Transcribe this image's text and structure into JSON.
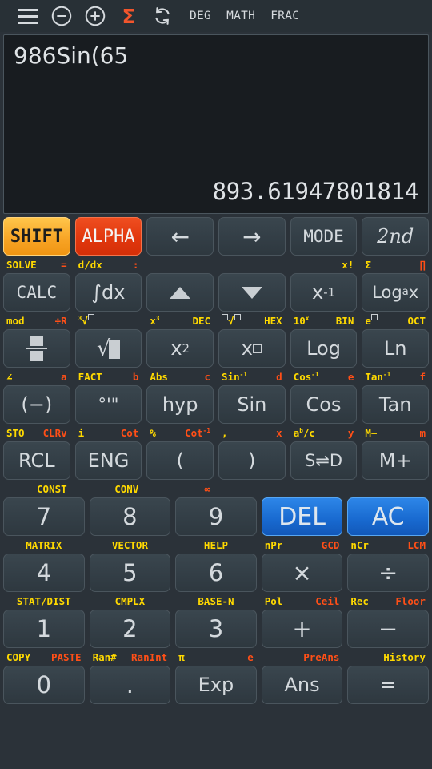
{
  "topbar": {
    "menu_icon": "hamburger-menu-icon",
    "zoom_out_icon": "minus-circle-icon",
    "zoom_in_icon": "plus-circle-icon",
    "sigma_icon": "Σ",
    "refresh_icon": "refresh-icon",
    "modes": [
      "DEG",
      "MATH",
      "FRAC"
    ]
  },
  "display": {
    "expression": "986Sin(65",
    "result": "893.61947801814"
  },
  "keys": [
    {
      "row": 1,
      "cells": [
        {
          "main": "SHIFT",
          "style": "shift",
          "name": "shift-key",
          "left": "SOLVE",
          "right": "=",
          "lc": "y",
          "rc": "r"
        },
        {
          "main": "ALPHA",
          "style": "alpha",
          "name": "alpha-key",
          "left": "d/dx",
          "right": ":",
          "lc": "y",
          "rc": "r"
        },
        {
          "main": "←",
          "style": "arrow",
          "name": "left-arrow-key",
          "left": "",
          "right": "",
          "lc": "y",
          "rc": "r"
        },
        {
          "main": "→",
          "style": "arrow",
          "name": "right-arrow-key",
          "left": "",
          "right": "",
          "lc": "y",
          "rc": "r"
        },
        {
          "main": "MODE",
          "style": "mono",
          "name": "mode-key",
          "left": "",
          "right": "x!",
          "lc": "y",
          "rc": "y"
        },
        {
          "main": "2nd",
          "style": "italic",
          "name": "second-key",
          "left": "Σ",
          "right": "∏",
          "lc": "y",
          "rc": "r"
        }
      ]
    },
    {
      "row": 2,
      "cells": [
        {
          "main": "CALC",
          "style": "mono",
          "name": "calc-key",
          "left": "mod",
          "right": "÷R",
          "lc": "y",
          "rc": "r"
        },
        {
          "main": "∫dx",
          "style": "plain",
          "name": "integral-key",
          "left": "³√□",
          "right": "",
          "lc": "y",
          "rc": "r"
        },
        {
          "main": "▲",
          "style": "up",
          "name": "up-arrow-key",
          "left": "x³",
          "right": "DEC",
          "lc": "y",
          "rc": "y"
        },
        {
          "main": "▼",
          "style": "down",
          "name": "down-arrow-key",
          "left": "□√□",
          "right": "HEX",
          "lc": "y",
          "rc": "y"
        },
        {
          "main": "x⁻¹",
          "style": "inv",
          "name": "inverse-key",
          "left": "10ˣ",
          "right": "BIN",
          "lc": "y",
          "rc": "y"
        },
        {
          "main": "Logₐx",
          "style": "logax",
          "name": "log-base-a-key",
          "left": "e□",
          "right": "OCT",
          "lc": "y",
          "rc": "y"
        }
      ]
    },
    {
      "row": 3,
      "cells": [
        {
          "main": "fraction",
          "style": "frac",
          "name": "fraction-key",
          "left": "∠",
          "right": "a",
          "lc": "y",
          "rc": "r"
        },
        {
          "main": "√□",
          "style": "sqrt",
          "name": "sqrt-key",
          "left": "FACT",
          "right": "b",
          "lc": "y",
          "rc": "r"
        },
        {
          "main": "x²",
          "style": "sq",
          "name": "square-key",
          "left": "Abs",
          "right": "c",
          "lc": "y",
          "rc": "r"
        },
        {
          "main": "x□",
          "style": "pow",
          "name": "power-key",
          "left": "Sin⁻¹",
          "right": "d",
          "lc": "y",
          "rc": "r"
        },
        {
          "main": "Log",
          "style": "plain",
          "name": "log-key",
          "left": "Cos⁻¹",
          "right": "e",
          "lc": "y",
          "rc": "r"
        },
        {
          "main": "Ln",
          "style": "plain",
          "name": "ln-key",
          "left": "Tan⁻¹",
          "right": "f",
          "lc": "y",
          "rc": "r"
        }
      ]
    },
    {
      "row": 4,
      "cells": [
        {
          "main": "(−)",
          "style": "plain",
          "name": "negative-key",
          "left": "STO",
          "right": "CLRv",
          "lc": "y",
          "rc": "r"
        },
        {
          "main": "°'\"",
          "style": "dms",
          "name": "dms-key",
          "left": "i",
          "right": "Cot",
          "lc": "y",
          "rc": "r"
        },
        {
          "main": "hyp",
          "style": "plain",
          "name": "hyp-key",
          "left": "%",
          "right": "Cot⁻¹",
          "lc": "y",
          "rc": "r"
        },
        {
          "main": "Sin",
          "style": "plain",
          "name": "sin-key",
          "left": ",",
          "right": "x",
          "lc": "y",
          "rc": "r"
        },
        {
          "main": "Cos",
          "style": "plain",
          "name": "cos-key",
          "left": "aᵇ/c",
          "right": "y",
          "lc": "y",
          "rc": "r"
        },
        {
          "main": "Tan",
          "style": "plain",
          "name": "tan-key",
          "left": "M−",
          "right": "m",
          "lc": "y",
          "rc": "r"
        }
      ]
    },
    {
      "row": 5,
      "cells": [
        {
          "main": "RCL",
          "style": "plain",
          "name": "rcl-key",
          "left": "",
          "right": "CONST",
          "lc": "y",
          "rc": "y"
        },
        {
          "main": "ENG",
          "style": "plain",
          "name": "eng-key",
          "left": "",
          "right": "CONV",
          "lc": "y",
          "rc": "y"
        },
        {
          "main": "(",
          "style": "plain",
          "name": "open-paren-key",
          "left": "",
          "right": "∞",
          "lc": "y",
          "rc": "r"
        },
        {
          "main": ")",
          "style": "plain",
          "name": "close-paren-key",
          "left": "",
          "right": "",
          "lc": "y",
          "rc": "r"
        },
        {
          "main": "S⇌D",
          "style": "sd",
          "name": "sd-toggle-key",
          "left": "",
          "right": "",
          "lc": "y",
          "rc": "r"
        },
        {
          "main": "M+",
          "style": "plain",
          "name": "memory-plus-key",
          "left": "",
          "right": "",
          "lc": "y",
          "rc": "r"
        }
      ]
    },
    {
      "row": 6,
      "cells": [
        {
          "main": "7",
          "style": "num",
          "name": "digit-7-key",
          "left": "",
          "right": "MATRIX",
          "lc": "y",
          "rc": "y",
          "center": true
        },
        {
          "main": "8",
          "style": "num",
          "name": "digit-8-key",
          "left": "",
          "right": "VECTOR",
          "lc": "y",
          "rc": "y",
          "center": true
        },
        {
          "main": "9",
          "style": "num",
          "name": "digit-9-key",
          "left": "",
          "right": "HELP",
          "lc": "y",
          "rc": "y",
          "center": true
        },
        {
          "main": "DEL",
          "style": "blue",
          "name": "delete-key",
          "left": "nPr",
          "right": "GCD",
          "lc": "y",
          "rc": "r"
        },
        {
          "main": "AC",
          "style": "blue",
          "name": "all-clear-key",
          "left": "nCr",
          "right": "LCM",
          "lc": "y",
          "rc": "r"
        }
      ]
    },
    {
      "row": 7,
      "cells": [
        {
          "main": "4",
          "style": "num",
          "name": "digit-4-key",
          "left": "",
          "right": "STAT/DIST",
          "lc": "y",
          "rc": "y",
          "center": true
        },
        {
          "main": "5",
          "style": "num",
          "name": "digit-5-key",
          "left": "",
          "right": "CMPLX",
          "lc": "y",
          "rc": "y",
          "center": true
        },
        {
          "main": "6",
          "style": "num",
          "name": "digit-6-key",
          "left": "",
          "right": "BASE-N",
          "lc": "y",
          "rc": "y",
          "center": true
        },
        {
          "main": "×",
          "style": "op",
          "name": "multiply-key",
          "left": "Pol",
          "right": "Ceil",
          "lc": "y",
          "rc": "r"
        },
        {
          "main": "÷",
          "style": "op",
          "name": "divide-key",
          "left": "Rec",
          "right": "Floor",
          "lc": "y",
          "rc": "r"
        }
      ]
    },
    {
      "row": 8,
      "cells": [
        {
          "main": "1",
          "style": "num",
          "name": "digit-1-key",
          "left": "COPY",
          "right": "PASTE",
          "lc": "y",
          "rc": "r"
        },
        {
          "main": "2",
          "style": "num",
          "name": "digit-2-key",
          "left": "Ran#",
          "right": "RanInt",
          "lc": "y",
          "rc": "r"
        },
        {
          "main": "3",
          "style": "num",
          "name": "digit-3-key",
          "left": "π",
          "right": "e",
          "lc": "y",
          "rc": "r"
        },
        {
          "main": "+",
          "style": "op",
          "name": "plus-key",
          "left": "",
          "right": "PreAns",
          "lc": "y",
          "rc": "r"
        },
        {
          "main": "−",
          "style": "op",
          "name": "minus-key",
          "left": "",
          "right": "History",
          "lc": "y",
          "rc": "y"
        }
      ]
    },
    {
      "row": 9,
      "cells": [
        {
          "main": "0",
          "style": "num",
          "name": "digit-0-key",
          "left": "",
          "right": "",
          "lc": "y",
          "rc": "r"
        },
        {
          "main": ".",
          "style": "num",
          "name": "decimal-point-key",
          "left": "",
          "right": "",
          "lc": "y",
          "rc": "r"
        },
        {
          "main": "Exp",
          "style": "plain",
          "name": "exponent-key",
          "left": "",
          "right": "",
          "lc": "y",
          "rc": "r"
        },
        {
          "main": "Ans",
          "style": "plain",
          "name": "answer-key",
          "left": "",
          "right": "",
          "lc": "y",
          "rc": "r"
        },
        {
          "main": "=",
          "style": "plain",
          "name": "equals-key",
          "left": "",
          "right": "",
          "lc": "y",
          "rc": "r"
        }
      ]
    }
  ]
}
